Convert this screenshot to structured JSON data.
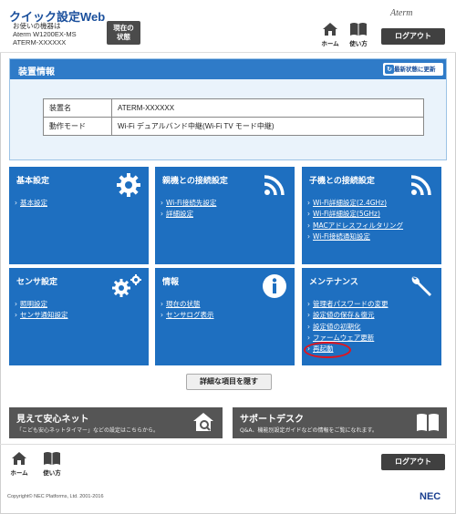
{
  "header": {
    "app_title": "クイック設定Web",
    "device_label": "お使いの機器は",
    "device_model": "Aterm W1200EX-MS",
    "device_name": "ATERM-XXXXXX",
    "status_button": [
      "現在の",
      "状態"
    ],
    "brand": "Aterm",
    "home_label": "ホーム",
    "manual_label": "使い方",
    "logout_label": "ログアウト"
  },
  "device_panel": {
    "title": "装置情報",
    "refresh_label": "最新状態に更新",
    "rows": [
      {
        "key": "装置名",
        "value": "ATERM-XXXXXX"
      },
      {
        "key": "動作モード",
        "value": "Wi-Fi デュアルバンド中継(Wi-Fi TV モード中継)"
      }
    ]
  },
  "tiles": [
    {
      "title": "基本設定",
      "icon": "gear-icon",
      "links": [
        "基本設定"
      ]
    },
    {
      "title": "親機との接続設定",
      "icon": "wifi-icon",
      "links": [
        "Wi-Fi接続先設定",
        "詳細設定"
      ]
    },
    {
      "title": "子機との接続設定",
      "icon": "wifi-icon",
      "links": [
        "Wi-Fi詳細設定(2.4GHz)",
        "Wi-Fi詳細設定(5GHz)",
        "MACアドレスフィルタリング",
        "Wi-Fi接続通知設定"
      ]
    },
    {
      "title": "センサ設定",
      "icon": "gears-icon",
      "links": [
        "照明設定",
        "センサ通知設定"
      ]
    },
    {
      "title": "情報",
      "icon": "info-icon",
      "links": [
        "現在の状態",
        "センサログ表示"
      ]
    },
    {
      "title": "メンテナンス",
      "icon": "wrench-icon",
      "links": [
        "管理者パスワードの変更",
        "設定値の保存＆復元",
        "設定値の初期化",
        "ファームウェア更新",
        "再起動"
      ]
    }
  ],
  "detail_button": "詳細な項目を隠す",
  "bottom_tiles": [
    {
      "title": "見えて安心ネット",
      "subtitle": "「こども安心ネットタイマー」などの設定はこちらから。",
      "icon": "house-search-icon"
    },
    {
      "title": "サポートデスク",
      "subtitle": "Q&A、機能別設定ガイドなどの情報をご覧になれます。",
      "icon": "book-icon"
    }
  ],
  "footer": {
    "home_label": "ホーム",
    "manual_label": "使い方",
    "logout_label": "ログアウト",
    "copyright": "Copyright© NEC Platforms, Ltd. 2001-2016",
    "logo": "NEC"
  },
  "colors": {
    "tile_blue": "#1e6fc0",
    "highlight_red": "#e0141e"
  }
}
